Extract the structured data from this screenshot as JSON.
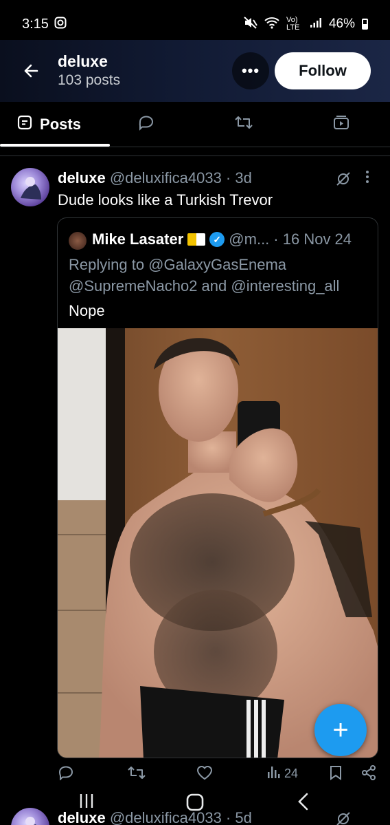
{
  "status_bar": {
    "time": "3:15",
    "battery": "46%",
    "network": "Vo) LTE"
  },
  "header": {
    "name": "deluxe",
    "post_count": "103 posts",
    "follow_label": "Follow",
    "more_label": "•••"
  },
  "tabs": [
    {
      "label": "Posts",
      "icon": "posts-icon",
      "active": true
    },
    {
      "label": "",
      "icon": "replies-icon",
      "active": false
    },
    {
      "label": "",
      "icon": "retweet-icon",
      "active": false
    },
    {
      "label": "",
      "icon": "media-icon",
      "active": false
    }
  ],
  "post": {
    "author": "deluxe",
    "handle": "@deluxifica4033 · 3d",
    "text": "Dude looks like a Turkish Trevor",
    "quote": {
      "author": "Mike Lasater",
      "handle": "@m...",
      "date": "· 16 Nov 24",
      "reply_line1": "Replying to @GalaxyGasEnema",
      "reply_line2": "@SupremeNacho2 and @interesting_all",
      "text": "Nope"
    },
    "actions": {
      "views": "24"
    }
  },
  "next_post": {
    "author": "deluxe",
    "handle": "@deluxifica4033 · 5d"
  },
  "fab_label": "+",
  "colors": {
    "accent": "#1d9bf0",
    "background": "#000000",
    "muted": "#8b98a5"
  }
}
